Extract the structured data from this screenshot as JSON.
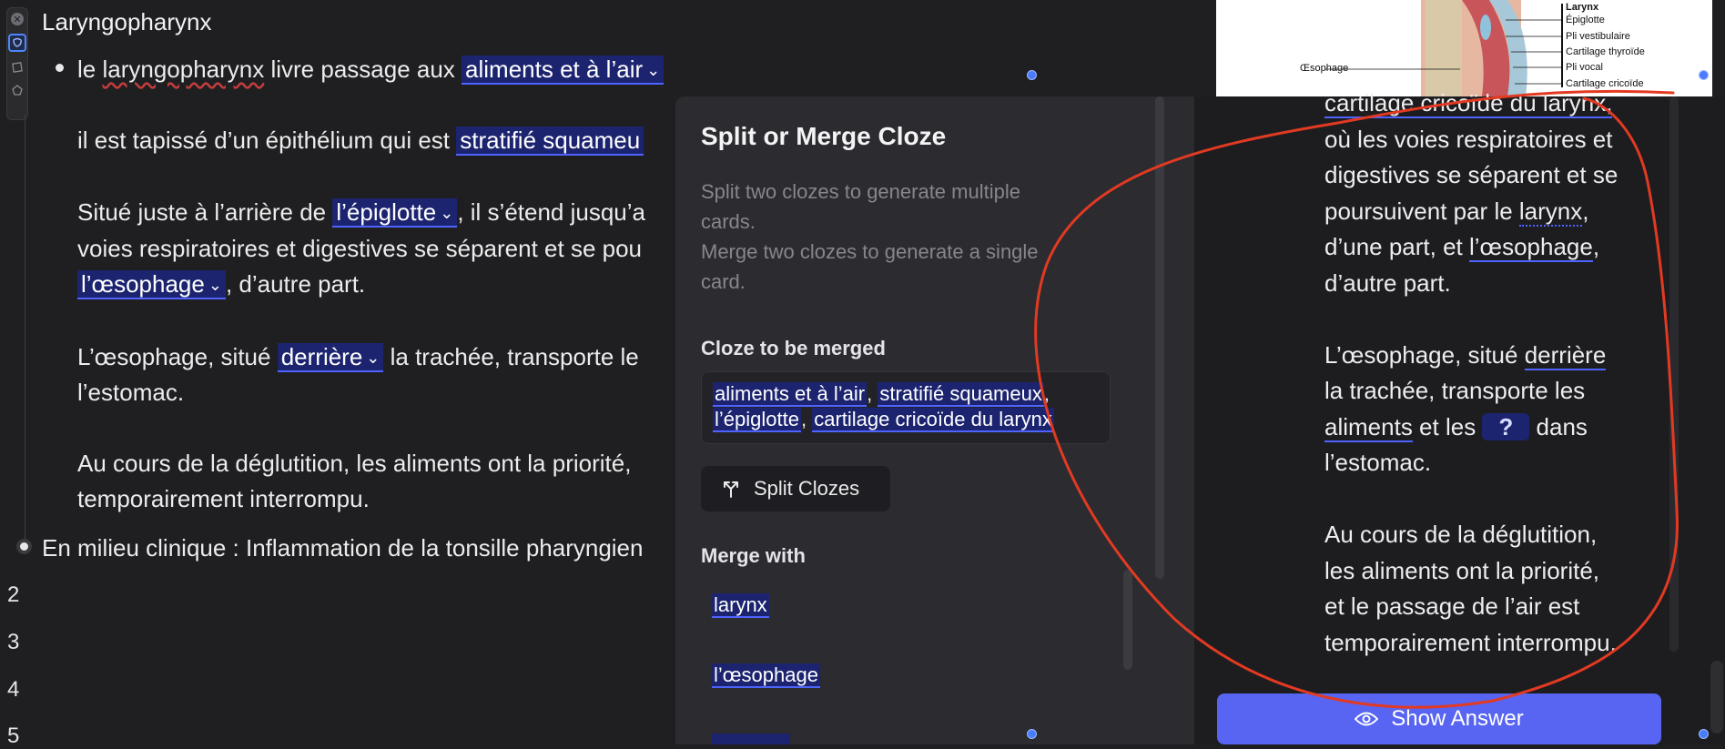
{
  "editor": {
    "title": "Laryngopharynx",
    "bullet1": {
      "pre": "le ",
      "word_wavy": "laryngopharynx",
      "mid": " livre passage aux ",
      "cloze": "aliments et à l’air"
    },
    "p2": {
      "pre": "il est tapissé d’un épithélium  qui est ",
      "cloze": "stratifié squameu"
    },
    "p3": {
      "pre": "Situé juste à l’arrière de ",
      "cloze": "l’épiglotte",
      "post": ", il s’étend jusqu’a",
      "line2": "voies respiratoires et digestives se séparent et se pou",
      "cloze2": "l’œsophage",
      "post2": ", d’autre part."
    },
    "p4": {
      "pre": "L’œsophage, situé ",
      "cloze": "derrière",
      "post": " la trachée, transporte le",
      "line2": "l’estomac."
    },
    "p5": {
      "line1": "Au cours de la déglutition, les aliments ont la priorité,",
      "line2": "temporairement interrompu."
    },
    "bullet2": "En milieu clinique : Inflammation de la tonsille pharyngien",
    "line_numbers": [
      "2",
      "3",
      "4",
      "5"
    ],
    "chevron": "⌄"
  },
  "modal": {
    "title": "Split or Merge Cloze",
    "desc1": "Split two clozes to generate multiple",
    "desc2": "cards.",
    "desc3": "Merge two clozes to generate a single",
    "desc4": "card.",
    "cloze_label": "Cloze to be merged",
    "clozes": [
      "aliments et à l’air",
      "stratifié squameux",
      "l’épiglotte",
      "cartilage cricoïde du larynx"
    ],
    "sep": ",",
    "split_button": "Split Clozes",
    "merge_label": "Merge with",
    "merge_items": [
      "larynx",
      "l’œsophage"
    ]
  },
  "card": {
    "top_partial": "cartilage cricoïde du larynx,",
    "l1": "où les voies respiratoires et",
    "l2": "digestives se séparent et se",
    "l3_pre": "poursuivent par le ",
    "l3_u": "larynx",
    "l3_post": ",",
    "l4_pre": "d’une part, et ",
    "l4_u": "l’œsophage",
    "l4_post": ",",
    "l5": "d’autre part.",
    "l6_pre": "L’œsophage, situé ",
    "l6_u": "derrière",
    "l7": "la trachée, transporte les",
    "l8_u": "aliments",
    "l8_mid": " et les ",
    "l8_q": "?",
    "l8_post": " dans",
    "l9": "l’estomac.",
    "l10": "Au cours de la déglutition,",
    "l11": "les aliments ont la priorité,",
    "l12": "et le passage de l’air est",
    "l13": "temporairement interrompu.",
    "show_answer": "Show Answer"
  },
  "anatomy": {
    "title": "Larynx",
    "labels": [
      "Épiglotte",
      "Pli vestibulaire",
      "Cartilage thyroïde",
      "Pli vocal",
      "Cartilage cricoïde"
    ],
    "oesophage": "Œsophage"
  },
  "colors": {
    "cloze_bg": "#1c2470",
    "cloze_underline": "#4f63ff",
    "show_answer_bg": "#5865f2",
    "annotation_red": "#e23a22"
  }
}
